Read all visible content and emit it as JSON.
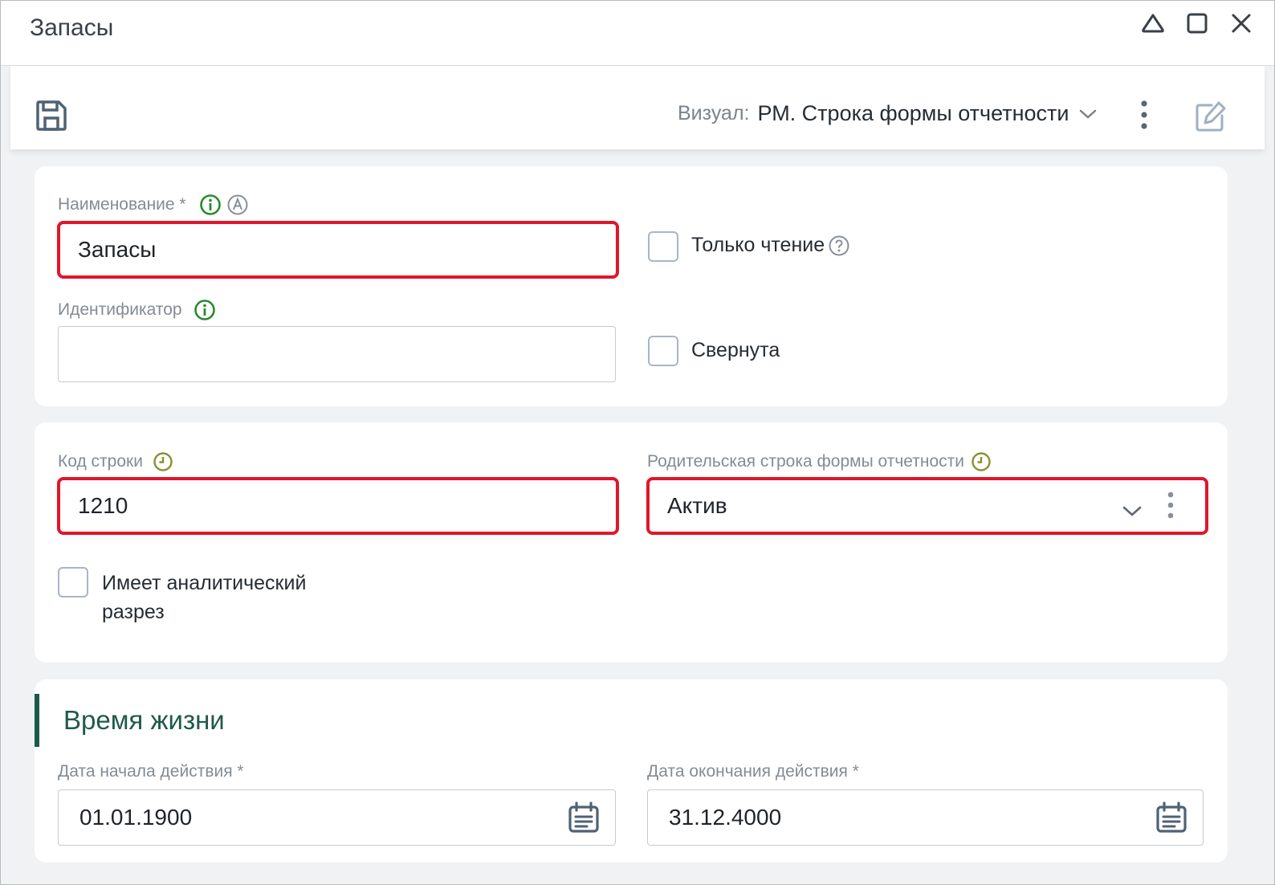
{
  "window": {
    "title": "Запасы"
  },
  "toolbar": {
    "visual_label": "Визуал:",
    "visual_value": "РМ. Строка формы отчетности"
  },
  "card1": {
    "name_label": "Наименование *",
    "name_value": "Запасы",
    "id_label": "Идентификатор",
    "id_value": "",
    "readonly_label": "Только чтение",
    "collapsed_label": "Свернута"
  },
  "card2": {
    "code_label": "Код строки",
    "code_value": "1210",
    "parent_label": "Родительская строка формы отчетности",
    "parent_value": "Актив",
    "analytic_label": "Имеет аналитический разрез"
  },
  "lifetime": {
    "title": "Время жизни",
    "start_label": "Дата начала действия *",
    "start_value": "01.01.1900",
    "end_label": "Дата окончания действия *",
    "end_value": "31.12.4000"
  },
  "colors": {
    "highlight": "#e0162b",
    "info_green": "#2b8a2e",
    "clock_olive": "#8a8f2e",
    "section_accent": "#1a5a48"
  }
}
